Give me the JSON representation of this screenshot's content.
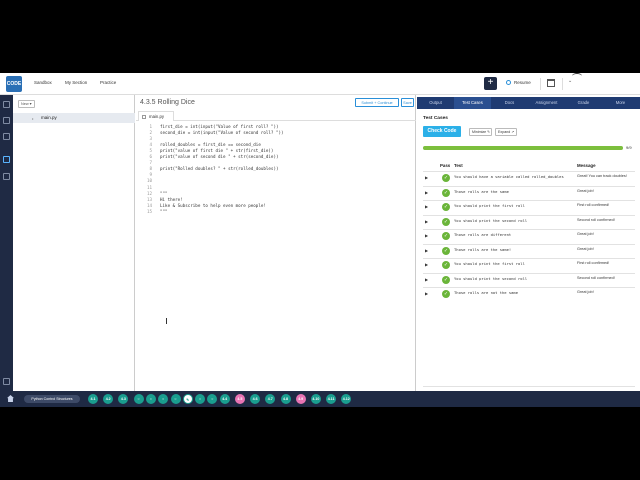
{
  "topbar": {
    "logo_text": "CODE",
    "nav": [
      "Sandbox",
      "My Section",
      "Practice"
    ],
    "add_label": "+",
    "resume_label": "Resume"
  },
  "filepanel": {
    "new_label": "New",
    "file_name": "main.py"
  },
  "editor": {
    "title": "4.3.5 Rolling Dice",
    "submit_label": "Submit + Continue",
    "save_label": "Save",
    "tab_name": "main.py",
    "lines": [
      {
        "n": "1",
        "t": "first_die = int(input(\"Value of first roll? \"))"
      },
      {
        "n": "2",
        "t": "second_die = int(input(\"Value of second roll? \"))"
      },
      {
        "n": "3",
        "t": ""
      },
      {
        "n": "4",
        "t": "rolled_doubles = first_die == second_die"
      },
      {
        "n": "5",
        "t": "print(\"value of first die \" + str(first_die))"
      },
      {
        "n": "6",
        "t": "print(\"value of second die \" + str(second_die))"
      },
      {
        "n": "7",
        "t": ""
      },
      {
        "n": "8",
        "t": "print(\"Rolled doubles? \" + str(rolled_doubles))"
      },
      {
        "n": "9",
        "t": ""
      },
      {
        "n": "10",
        "t": ""
      },
      {
        "n": "11",
        "t": ""
      },
      {
        "n": "12",
        "t": "\"\"\""
      },
      {
        "n": "13",
        "t": "Hi there!"
      },
      {
        "n": "14",
        "t": "Like & Subscribe to help even more people!"
      },
      {
        "n": "15",
        "t": "\"\"\""
      }
    ]
  },
  "right": {
    "tabs": [
      "Output",
      "Test Cases",
      "Docs",
      "Assignment",
      "Grade",
      "More"
    ],
    "active_tab": 1,
    "section_title": "Test Cases",
    "check_label": "Check Code",
    "minimize_label": "Minimize",
    "expand_label": "Expand",
    "progress": 1.0,
    "progress_label": "9/9",
    "headers": {
      "pass": "Pass",
      "test": "Test",
      "message": "Message"
    },
    "rows": [
      {
        "test": "You should have a variable called rolled_doubles",
        "message": "Great! You can track doubles!"
      },
      {
        "test": "Those rolls are the same",
        "message": "Great job!"
      },
      {
        "test": "You should print the first roll",
        "message": "First roll confirmed!"
      },
      {
        "test": "You should print the second roll",
        "message": "Second roll confirmed!"
      },
      {
        "test": "Those rolls are different",
        "message": "Great job!"
      },
      {
        "test": "Those rolls are the same!",
        "message": "Great job!"
      },
      {
        "test": "You should print the first roll",
        "message": "First roll confirmed!"
      },
      {
        "test": "You should print the second roll",
        "message": "Second roll confirmed!"
      },
      {
        "test": "Those rolls are not the same",
        "message": "Great job!"
      }
    ]
  },
  "bottombar": {
    "unit_label": "Python Control Structures",
    "crumbs": [
      {
        "label": "4.1",
        "kind": "teal"
      },
      {
        "label": "4.2",
        "kind": "teal"
      },
      {
        "label": "4.3",
        "kind": "teal"
      },
      {
        "label": "",
        "kind": "icon"
      },
      {
        "label": "",
        "kind": "icon"
      },
      {
        "label": "",
        "kind": "icon"
      },
      {
        "label": "",
        "kind": "icon"
      },
      {
        "label": "",
        "kind": "current"
      },
      {
        "label": "",
        "kind": "icon"
      },
      {
        "label": "",
        "kind": "icon"
      },
      {
        "label": "4.4",
        "kind": "teal"
      },
      {
        "label": "4.5",
        "kind": "pink"
      },
      {
        "label": "4.6",
        "kind": "teal"
      },
      {
        "label": "4.7",
        "kind": "teal"
      },
      {
        "label": "4.8",
        "kind": "teal"
      },
      {
        "label": "4.9",
        "kind": "pink"
      },
      {
        "label": "4.10",
        "kind": "teal"
      },
      {
        "label": "4.11",
        "kind": "teal"
      },
      {
        "label": "4.12",
        "kind": "teal"
      }
    ]
  },
  "colors": {
    "accent": "#2bb0e8",
    "nav": "#1f2a44",
    "pass": "#6ab539",
    "teal": "#1a9e8f",
    "pink": "#e874b4"
  }
}
